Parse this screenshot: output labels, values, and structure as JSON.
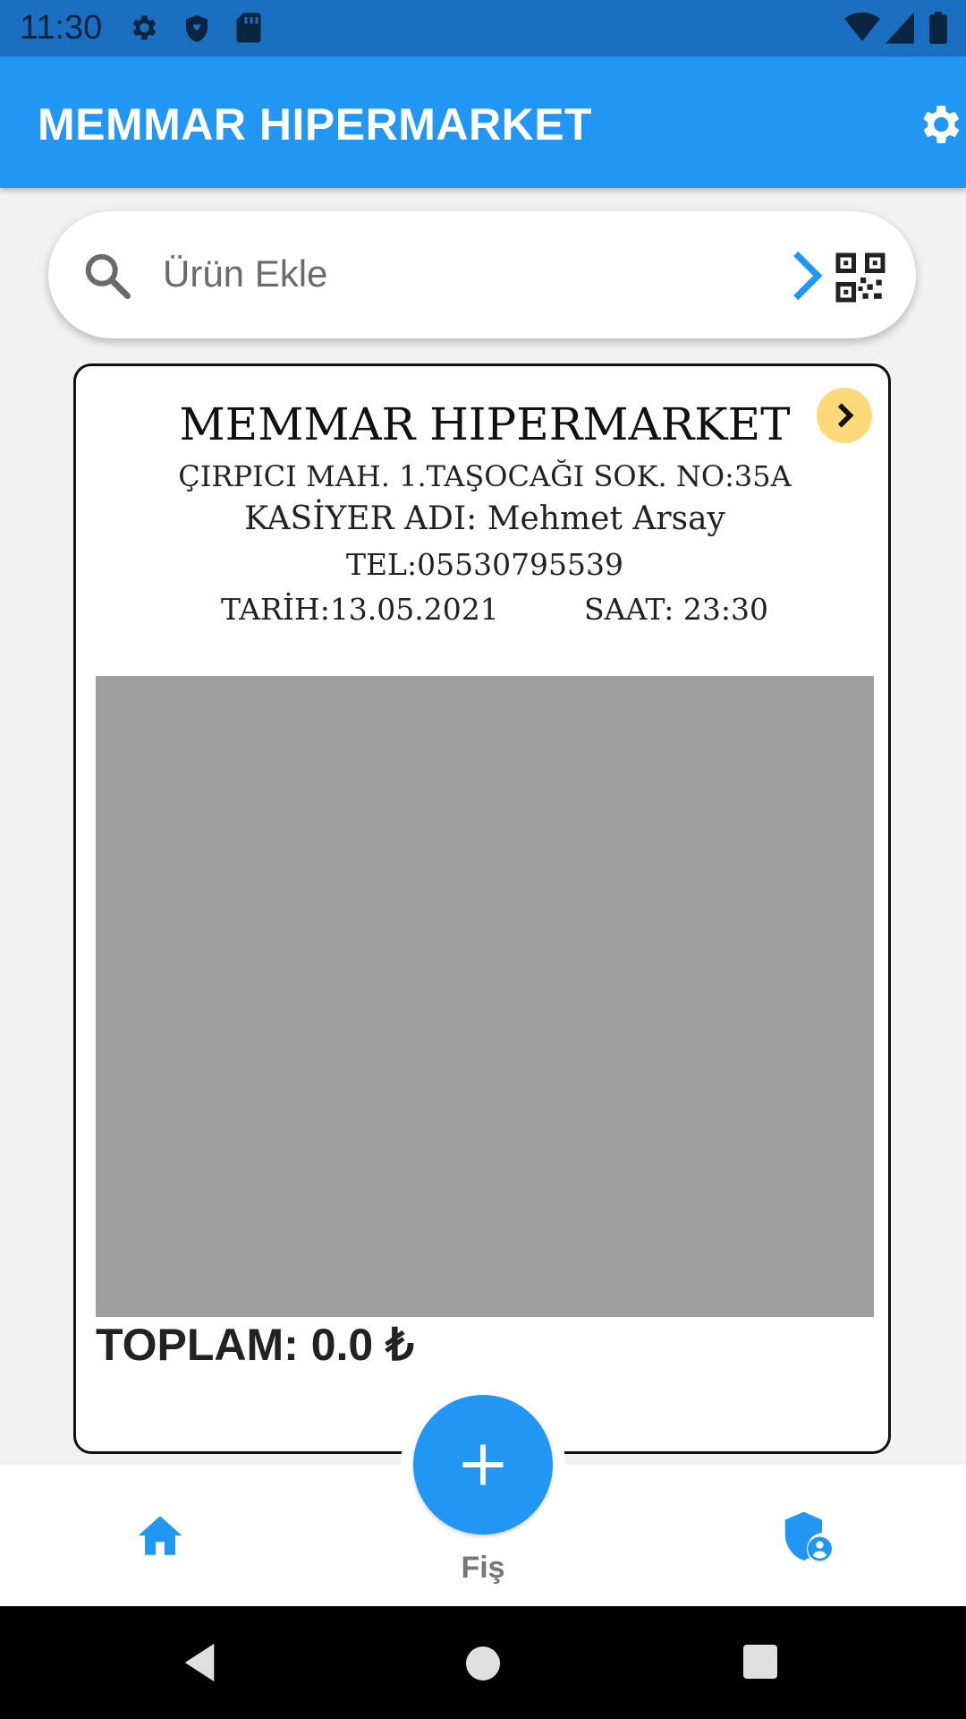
{
  "status_bar": {
    "time": "11:30",
    "icons": [
      "settings-icon",
      "shield-icon",
      "sd-card-icon",
      "wifi-icon",
      "signal-icon",
      "battery-icon"
    ]
  },
  "app_bar": {
    "title": "MEMMAR HIPERMARKET",
    "settings_icon": "gear-icon"
  },
  "search": {
    "placeholder": "Ürün Ekle",
    "value": ""
  },
  "receipt": {
    "store_name": "MEMMAR HIPERMARKET",
    "address": "ÇIRPICI MAH. 1.TAŞOCAĞI SOK. NO:35A",
    "cashier": "KASİYER ADI: Mehmet Arsay",
    "phone": "TEL:05530795539",
    "date": "TARİH:13.05.2021",
    "time": "SAAT: 23:30",
    "total": "TOPLAM: 0.0 ₺"
  },
  "bottom_nav": {
    "fab_label": "Fiş",
    "items": [
      "home-icon",
      "admin-shield-icon"
    ]
  },
  "colors": {
    "primary": "#2196f3",
    "status_bar": "#1b6fc0",
    "accent_button": "#ffd978",
    "items_area": "#9e9e9e"
  }
}
